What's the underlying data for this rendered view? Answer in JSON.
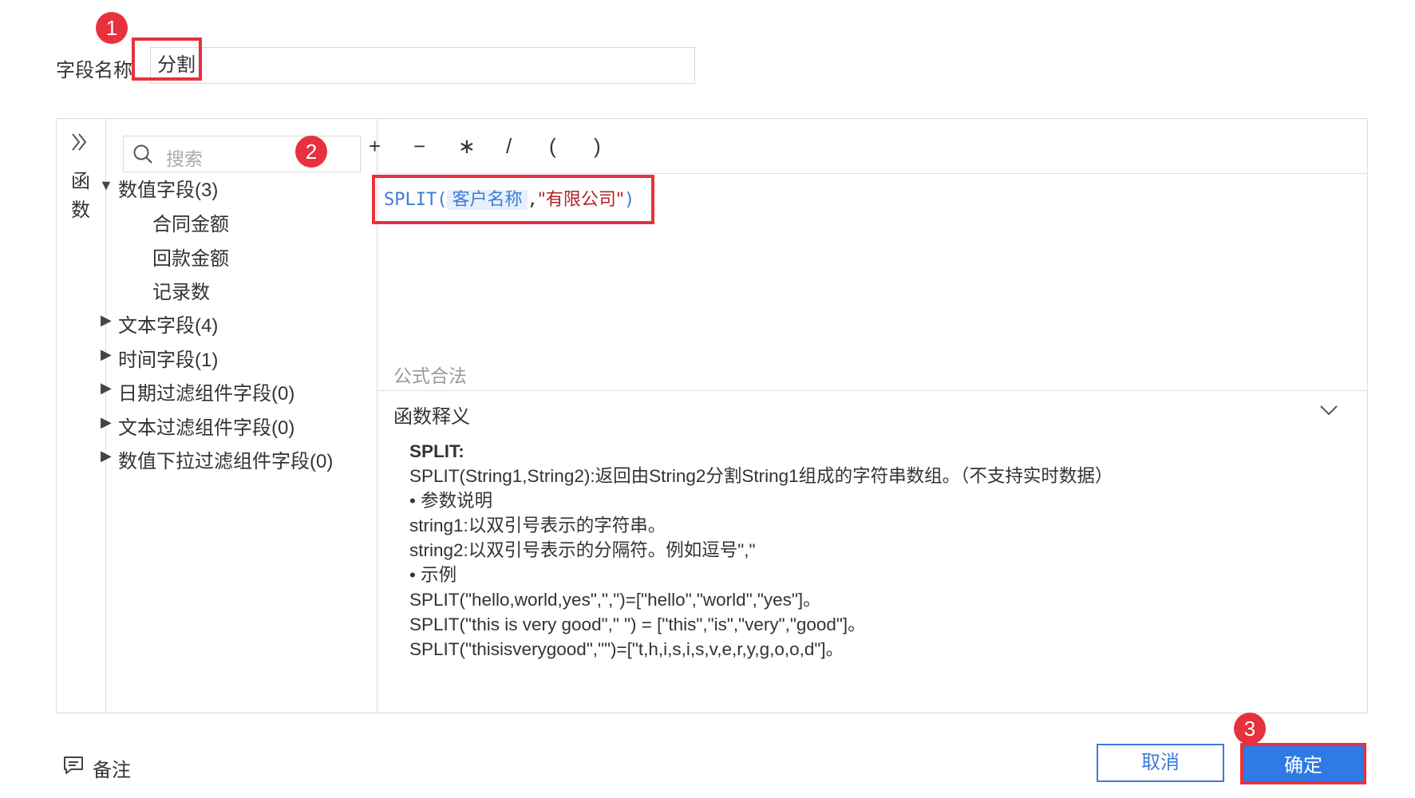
{
  "field_name": {
    "label": "字段名称",
    "value": "分割"
  },
  "annotations": {
    "badge_1": "1",
    "badge_2": "2",
    "badge_3": "3",
    "highlight_color": "#e8313e"
  },
  "rail": {
    "expand_icon": "double-chevron-right-icon",
    "label_line1": "函",
    "label_line2": "数"
  },
  "search": {
    "placeholder": "搜索",
    "icon": "search-icon"
  },
  "field_tree": {
    "groups": [
      {
        "label": "数值字段(3)",
        "expanded": true,
        "children": [
          "合同金额",
          "回款金额",
          "记录数"
        ]
      },
      {
        "label": "文本字段(4)",
        "expanded": false
      },
      {
        "label": "时间字段(1)",
        "expanded": false
      },
      {
        "label": "日期过滤组件字段(0)",
        "expanded": false
      },
      {
        "label": "文本过滤组件字段(0)",
        "expanded": false
      },
      {
        "label": "数值下拉过滤组件字段(0)",
        "expanded": false
      }
    ]
  },
  "operators": [
    "+",
    "−",
    "∗",
    "/",
    "(",
    ")"
  ],
  "formula": {
    "func": "SPLIT",
    "open": "(",
    "field": "客户名称",
    "comma": ",",
    "string": "\"有限公司\"",
    "close": ")"
  },
  "status": {
    "text": "公式合法"
  },
  "explanation": {
    "title": "函数释义",
    "toggle_icon": "chevron-down-icon",
    "func_name": "SPLIT:",
    "lines": [
      "SPLIT(String1,String2):返回由String2分割String1组成的字符串数组。（不支持实时数据）",
      "• 参数说明",
      "string1:以双引号表示的字符串。",
      "string2:以双引号表示的分隔符。例如逗号\",\"",
      "• 示例",
      "SPLIT(\"hello,world,yes\",\",\")=[\"hello\",\"world\",\"yes\"]。",
      "SPLIT(\"this is very good\",\" \") = [\"this\",\"is\",\"very\",\"good\"]。",
      "SPLIT(\"thisisverygood\",\"\")=[\"t,h,i,s,i,s,v,e,r,y,g,o,o,d\"]。"
    ]
  },
  "footer": {
    "note_icon": "comment-icon",
    "note_label": "备注",
    "cancel_label": "取消",
    "ok_label": "确定",
    "accent": "#2f7ae5"
  }
}
